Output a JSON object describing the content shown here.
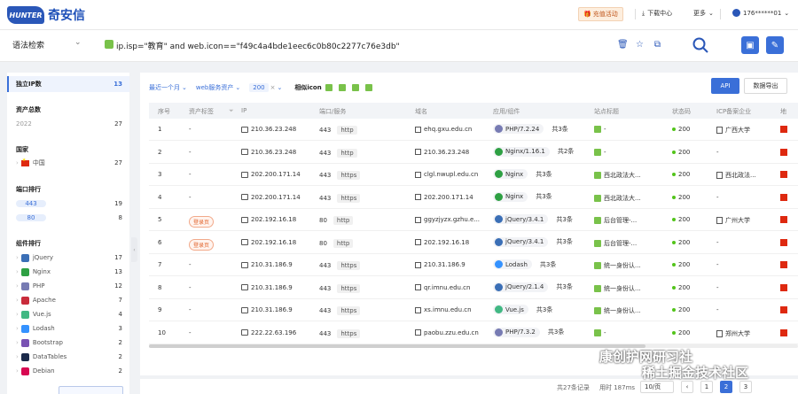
{
  "brand": {
    "name": "奇安信",
    "mark": "HUNTER"
  },
  "topbar": {
    "promo": "充值活动",
    "download": "下载中心",
    "more": "更多",
    "user": "176******01"
  },
  "search": {
    "mode": "语法检索",
    "query": "ip.isp=\"教育\" and web.icon==\"f49c4a4bde1eec6c0b80c2277c76e3db\""
  },
  "sidebar": {
    "unique_ip": {
      "label": "独立IP数",
      "count": "13"
    },
    "asset_total": {
      "title": "资产总数",
      "year": "2022",
      "count": "27"
    },
    "country": {
      "title": "国家",
      "items": [
        {
          "label": "中国",
          "count": "27"
        }
      ]
    },
    "ports": {
      "title": "端口排行",
      "items": [
        {
          "label": "443",
          "count": "19"
        },
        {
          "label": "80",
          "count": "8"
        }
      ]
    },
    "components": {
      "title": "组件排行",
      "items": [
        {
          "label": "jQuery",
          "count": "17",
          "color": "#3b6fb6"
        },
        {
          "label": "Nginx",
          "count": "13",
          "color": "#2ea043"
        },
        {
          "label": "PHP",
          "count": "12",
          "color": "#777bb3"
        },
        {
          "label": "Apache",
          "count": "7",
          "color": "#c92c3b"
        },
        {
          "label": "Vue.js",
          "count": "4",
          "color": "#41b883"
        },
        {
          "label": "Lodash",
          "count": "3",
          "color": "#3492ff"
        },
        {
          "label": "Bootstrap",
          "count": "2",
          "color": "#7952b3"
        },
        {
          "label": "DataTables",
          "count": "2",
          "color": "#1b2a4a"
        },
        {
          "label": "Debian",
          "count": "2",
          "color": "#d70751"
        }
      ]
    }
  },
  "filters": {
    "time": "最近一个月",
    "asset_type": "web服务资产",
    "status": "200",
    "similar_label": "相似icon"
  },
  "actions": {
    "api": "API",
    "export": "数据导出"
  },
  "table": {
    "headers": [
      "序号",
      "资产标签",
      "IP",
      "端口/服务",
      "域名",
      "应用/组件",
      "站点标题",
      "状态码",
      "ICP备案企业",
      "地"
    ],
    "rows": [
      {
        "no": "1",
        "tag": "-",
        "ip": "210.36.23.248",
        "port": "443",
        "proto": "http",
        "domain": "ehq.gxu.edu.cn",
        "app": "PHP/7.2.24",
        "app_color": "#777bb3",
        "total": "共3条",
        "title": "-",
        "status": "200",
        "icp": "广西大学"
      },
      {
        "no": "2",
        "tag": "-",
        "ip": "210.36.23.248",
        "port": "443",
        "proto": "http",
        "domain": "210.36.23.248",
        "app": "Nginx/1.16.1",
        "app_color": "#2ea043",
        "total": "共2条",
        "title": "-",
        "status": "200",
        "icp": "-"
      },
      {
        "no": "3",
        "tag": "-",
        "ip": "202.200.171.14",
        "port": "443",
        "proto": "https",
        "domain": "clgl.nwupl.edu.cn",
        "app": "Nginx",
        "app_color": "#2ea043",
        "total": "共3条",
        "title": "西北政法大...",
        "status": "200",
        "icp": "西北政法..."
      },
      {
        "no": "4",
        "tag": "-",
        "ip": "202.200.171.14",
        "port": "443",
        "proto": "https",
        "domain": "202.200.171.14",
        "app": "Nginx",
        "app_color": "#2ea043",
        "total": "共3条",
        "title": "西北政法大...",
        "status": "200",
        "icp": "-"
      },
      {
        "no": "5",
        "tag": "登录页",
        "ip": "202.192.16.18",
        "port": "80",
        "proto": "http",
        "domain": "ggyzjyzx.gzhu.e...",
        "app": "jQuery/3.4.1",
        "app_color": "#3b6fb6",
        "total": "共3条",
        "title": "后台管理-...",
        "status": "200",
        "icp": "广州大学"
      },
      {
        "no": "6",
        "tag": "登录页",
        "ip": "202.192.16.18",
        "port": "80",
        "proto": "http",
        "domain": "202.192.16.18",
        "app": "jQuery/3.4.1",
        "app_color": "#3b6fb6",
        "total": "共3条",
        "title": "后台管理-...",
        "status": "200",
        "icp": "-"
      },
      {
        "no": "7",
        "tag": "-",
        "ip": "210.31.186.9",
        "port": "443",
        "proto": "https",
        "domain": "210.31.186.9",
        "app": "Lodash",
        "app_color": "#3492ff",
        "total": "共3条",
        "title": "统一身份认...",
        "status": "200",
        "icp": "-"
      },
      {
        "no": "8",
        "tag": "-",
        "ip": "210.31.186.9",
        "port": "443",
        "proto": "https",
        "domain": "qr.imnu.edu.cn",
        "app": "jQuery/2.1.4",
        "app_color": "#3b6fb6",
        "total": "共3条",
        "title": "统一身份认...",
        "status": "200",
        "icp": "-"
      },
      {
        "no": "9",
        "tag": "-",
        "ip": "210.31.186.9",
        "port": "443",
        "proto": "https",
        "domain": "xs.imnu.edu.cn",
        "app": "Vue.js",
        "app_color": "#41b883",
        "total": "共3条",
        "title": "统一身份认...",
        "status": "200",
        "icp": "-"
      },
      {
        "no": "10",
        "tag": "-",
        "ip": "222.22.63.196",
        "port": "443",
        "proto": "https",
        "domain": "paobu.zzu.edu.cn",
        "app": "PHP/7.3.2",
        "app_color": "#777bb3",
        "total": "共3条",
        "title": "-",
        "status": "200",
        "icp": "郑州大学"
      }
    ]
  },
  "pagination": {
    "total": "共27条记录",
    "time": "用时 187ms",
    "size": "10/页",
    "pages": [
      "1",
      "2",
      "3"
    ],
    "current": "2"
  },
  "watermark": {
    "line1": "康创护网研习社",
    "line2": "稀土掘金技术社区"
  }
}
